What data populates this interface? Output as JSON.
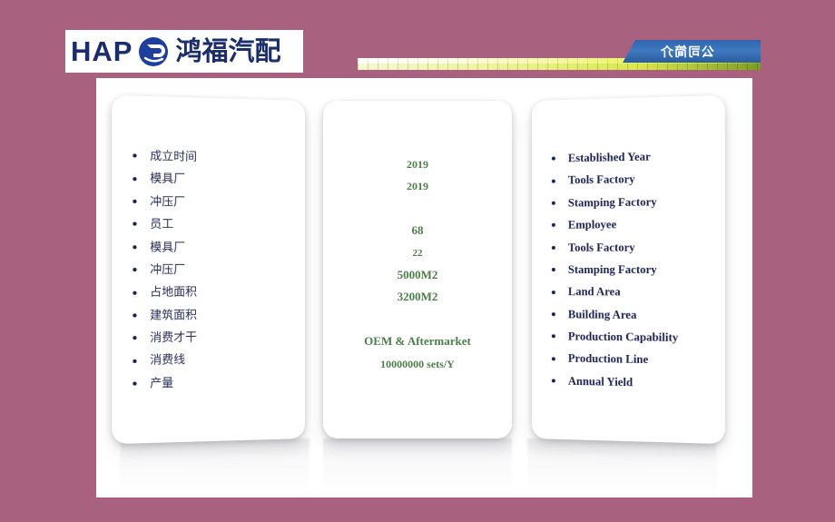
{
  "header": {
    "logo": {
      "wordmark": "HAP",
      "emblem_icon": "circular-p-emblem",
      "chinese_name": "鸿福汽配"
    },
    "ribbon_label": "公司简介",
    "ribbon_color": "#2f66ad",
    "gradient_bar": {
      "from_color": "#ffffff",
      "to_color": "#8fae28"
    }
  },
  "theme": {
    "background": "#a8627f",
    "panel": "#ffffff",
    "label_navy": "#1b2250",
    "value_green": "#4d7d49"
  },
  "cards": {
    "left": {
      "items": [
        {
          "label": "成立时间"
        },
        {
          "label": "模具厂"
        },
        {
          "label": "冲压厂"
        },
        {
          "label": "员工"
        },
        {
          "label": "模具厂"
        },
        {
          "label": "冲压厂"
        },
        {
          "label": "占地面积"
        },
        {
          "label": "建筑面积"
        },
        {
          "label": "消费才干"
        },
        {
          "label": "消费线"
        },
        {
          "label": "产量"
        }
      ]
    },
    "middle": {
      "values": [
        {
          "text": "2019",
          "size": "sz-m",
          "blank": false
        },
        {
          "text": "2019",
          "size": "sz-m",
          "blank": false
        },
        {
          "text": "",
          "size": "sz-m",
          "blank": true
        },
        {
          "text": "68",
          "size": "sz-l",
          "blank": false
        },
        {
          "text": "22",
          "size": "sz-s",
          "blank": false
        },
        {
          "text": "5000M2",
          "size": "sz-l",
          "blank": false
        },
        {
          "text": "3200M2",
          "size": "sz-l",
          "blank": false
        },
        {
          "text": "",
          "size": "sz-m",
          "blank": true
        },
        {
          "text": "OEM & Aftermarket",
          "size": "sz-l",
          "blank": false
        },
        {
          "text": "10000000 sets/Y",
          "size": "sz-m",
          "blank": false
        }
      ]
    },
    "right": {
      "items": [
        {
          "label": "Established Year"
        },
        {
          "label": "Tools Factory"
        },
        {
          "label": "Stamping Factory"
        },
        {
          "label": "Employee"
        },
        {
          "label": "Tools Factory"
        },
        {
          "label": "Stamping Factory"
        },
        {
          "label": "Land Area"
        },
        {
          "label": "Building Area"
        },
        {
          "label": "Production Capability"
        },
        {
          "label": "Production Line"
        },
        {
          "label": "Annual Yield"
        }
      ]
    }
  }
}
